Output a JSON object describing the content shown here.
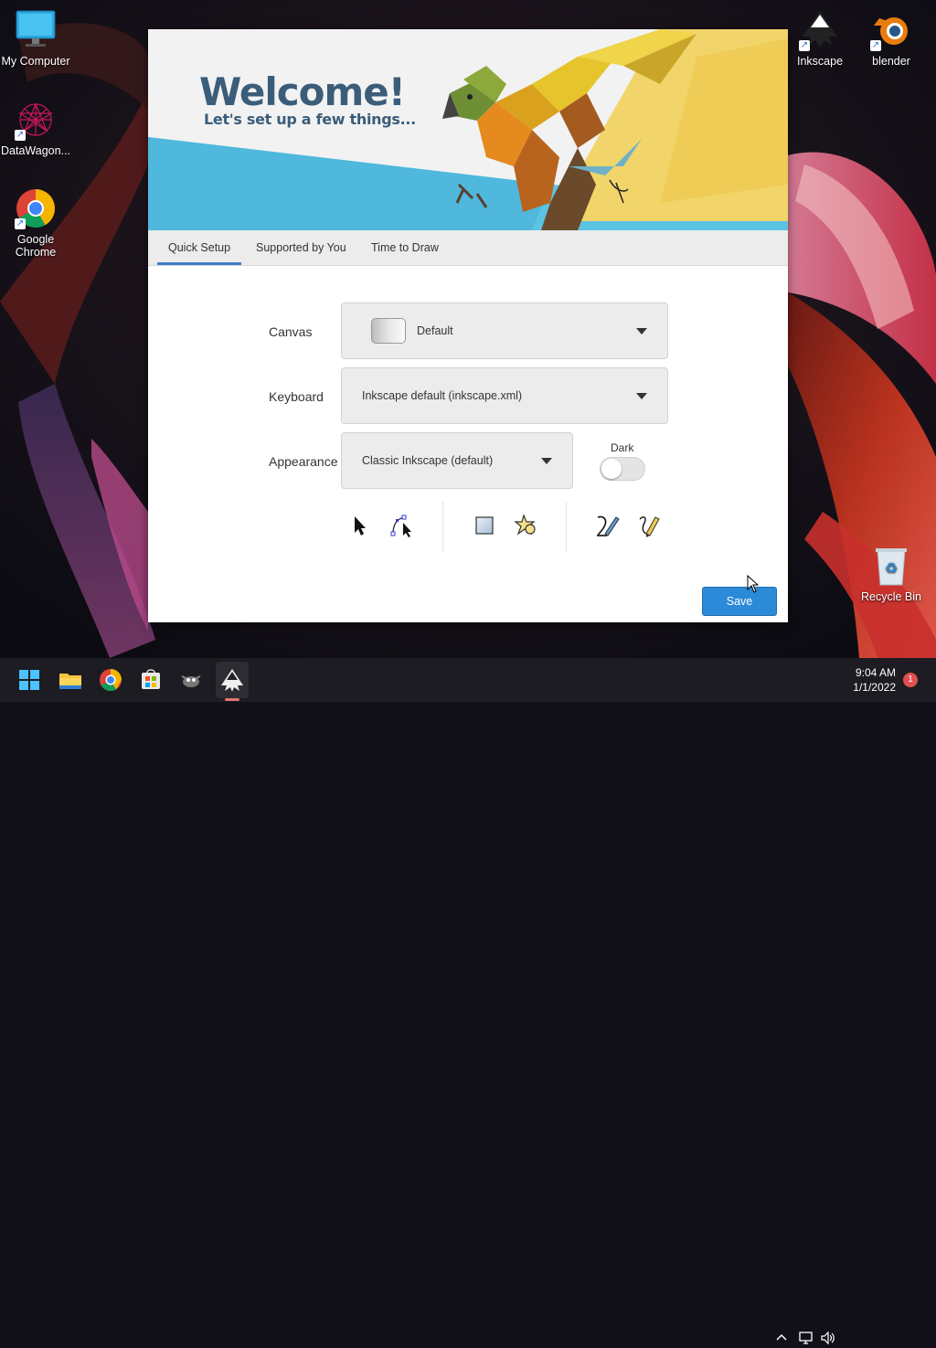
{
  "desktop": {
    "icons": [
      {
        "label": "My Computer"
      },
      {
        "label": "DataWagon..."
      },
      {
        "label": "Google Chrome"
      },
      {
        "label": "Inkscape"
      },
      {
        "label": "blender"
      },
      {
        "label": "Recycle Bin"
      }
    ]
  },
  "dialog": {
    "banner": {
      "title": "Welcome!",
      "subtitle": "Let's set up a few things..."
    },
    "tabs": [
      {
        "label": "Quick Setup",
        "active": true
      },
      {
        "label": "Supported by You",
        "active": false
      },
      {
        "label": "Time to Draw",
        "active": false
      }
    ],
    "settings": {
      "canvas": {
        "label": "Canvas",
        "value": "Default"
      },
      "keyboard": {
        "label": "Keyboard",
        "value": "Inkscape default (inkscape.xml)"
      },
      "appearance": {
        "label": "Appearance",
        "value": "Classic Inkscape (default)"
      },
      "dark": {
        "label": "Dark",
        "on": false
      }
    },
    "tool_preview": [
      "selector-icon",
      "node-editor-icon",
      "rectangle-icon",
      "star-icon",
      "calligraphy-icon",
      "pencil-icon"
    ],
    "save_label": "Save"
  },
  "taskbar": {
    "apps": [
      "start-icon",
      "file-explorer-icon",
      "chrome-icon",
      "store-icon",
      "gimp-icon",
      "inkscape-icon"
    ],
    "time": "9:04 AM",
    "date": "1/1/2022",
    "notification_count": "1"
  },
  "colors": {
    "accent": "#2b8bd8",
    "banner_text": "#3b5d7a",
    "banner_blue": "#5bc3e3",
    "banner_yellow": "#f2d56a",
    "taskbar_bg": "#1c1c22"
  }
}
